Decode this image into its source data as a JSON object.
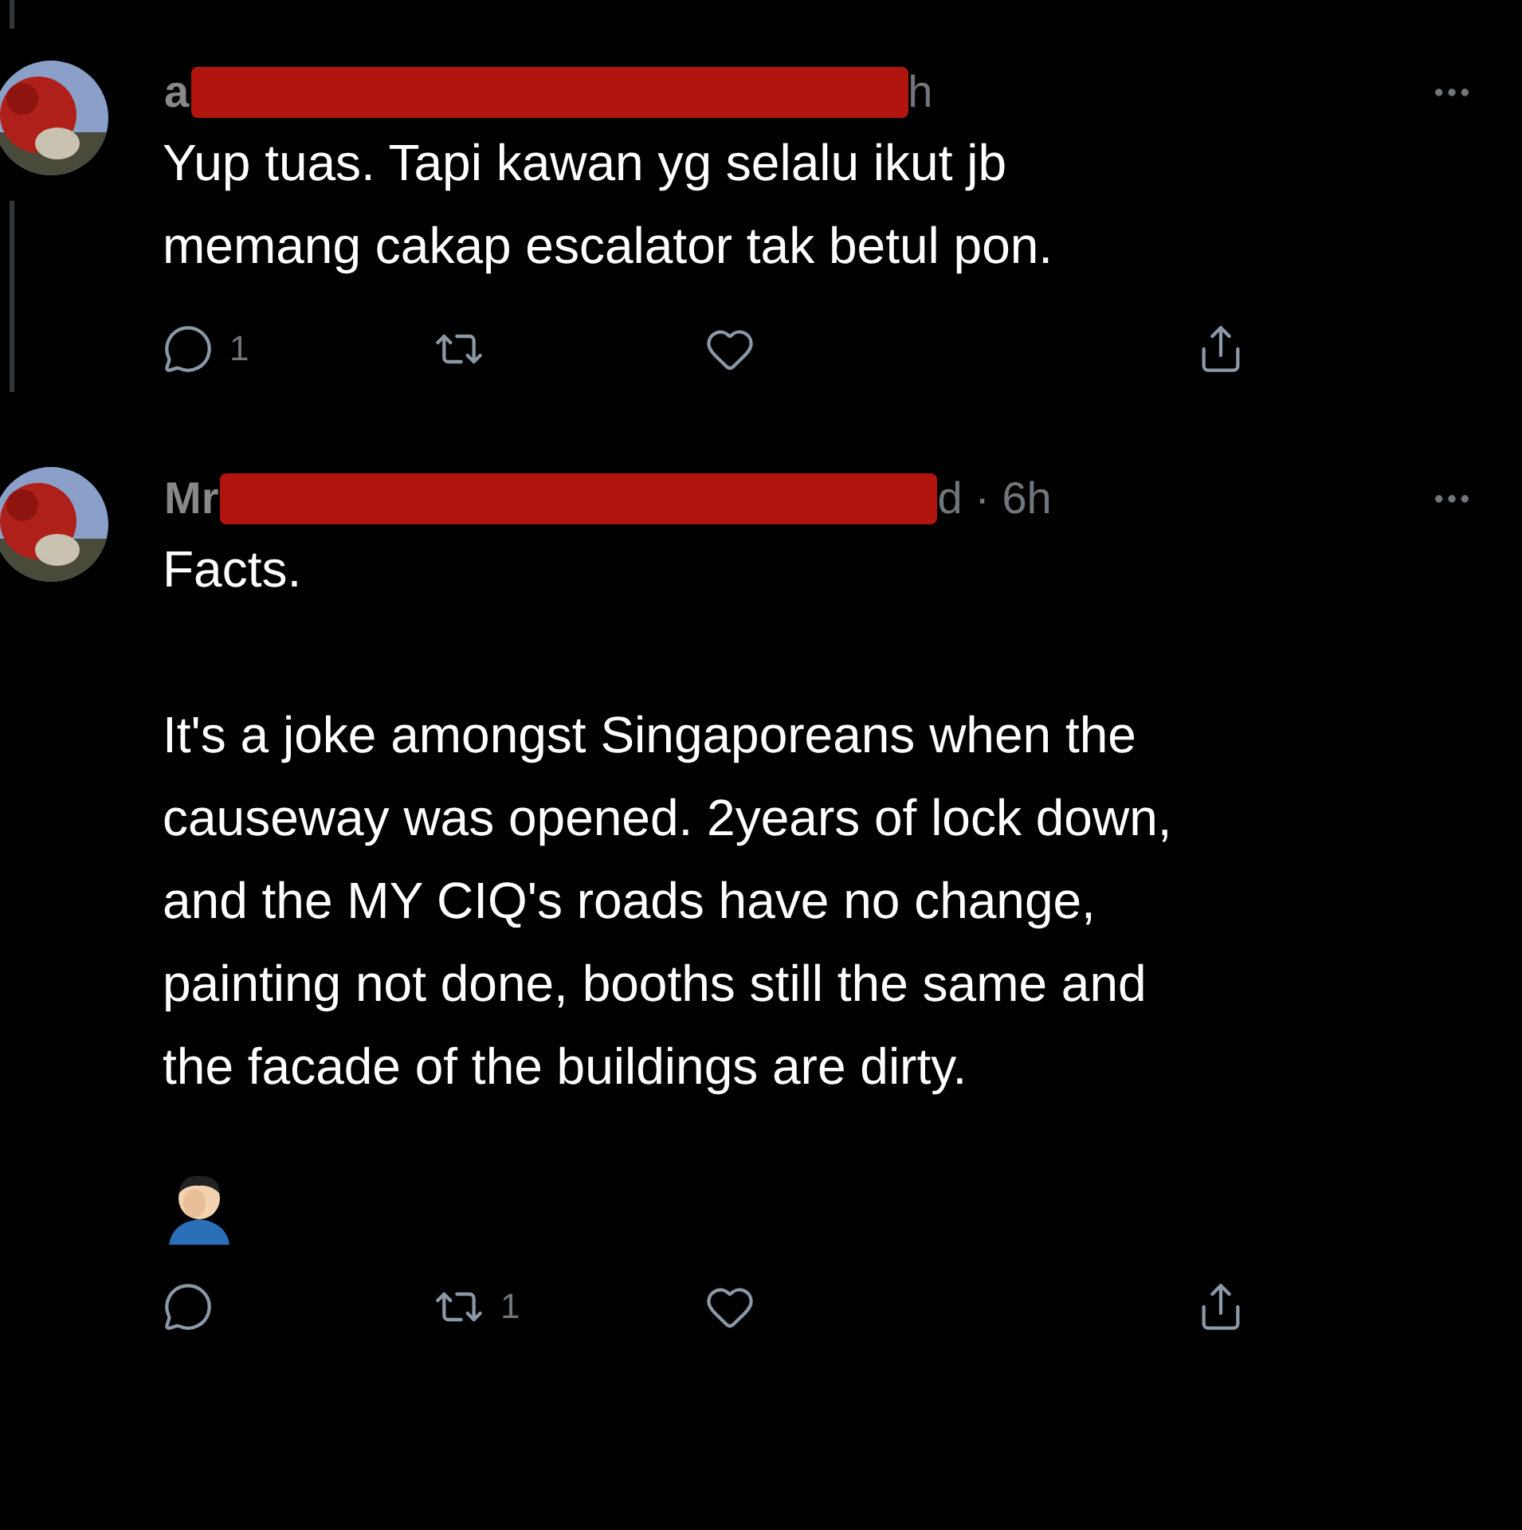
{
  "tweets": [
    {
      "name": "a",
      "handle_end": "h",
      "thread_above": true,
      "thread_below": true,
      "paragraphs": [
        "Yup tuas. Tapi kawan yg selalu ikut jb\nmemang cakap escalator tak betul pon."
      ],
      "has_emoji": false,
      "actions": [
        {
          "kind": "reply",
          "count": "1"
        },
        {
          "kind": "retweet"
        },
        {
          "kind": "like"
        },
        {
          "kind": "share"
        }
      ]
    },
    {
      "name": "Mr",
      "handle_end": "d · 6h",
      "thread_above": false,
      "thread_below": false,
      "paragraphs": [
        "Facts.",
        "It's a joke amongst Singaporeans when the\ncauseway was opened. 2years of lock down,\nand the MY CIQ's roads have no change,\npainting not done, booths still the same and\nthe facade of the buildings are dirty."
      ],
      "has_emoji": true,
      "actions": [
        {
          "kind": "reply"
        },
        {
          "kind": "retweet",
          "count": "1"
        },
        {
          "kind": "like"
        },
        {
          "kind": "share"
        }
      ]
    }
  ]
}
